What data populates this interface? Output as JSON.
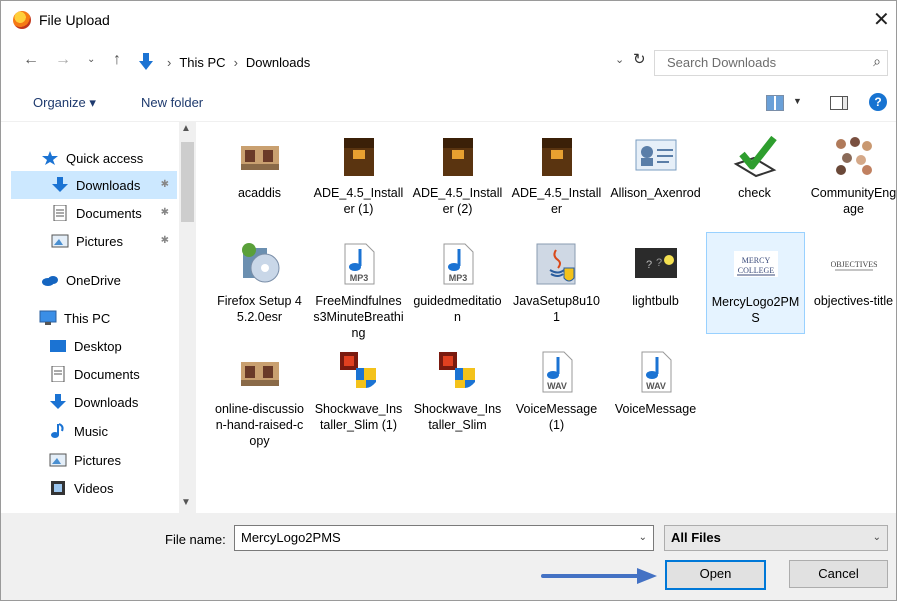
{
  "window": {
    "title": "File Upload",
    "close": "✕"
  },
  "address": {
    "crumbs": [
      "This PC",
      "Downloads"
    ],
    "search_placeholder": "Search Downloads"
  },
  "toolbar": {
    "organize": "Organize ▾",
    "new_folder": "New folder",
    "help": "?"
  },
  "sidebar": {
    "items": [
      {
        "label": "Quick access"
      },
      {
        "label": "Downloads"
      },
      {
        "label": "Documents"
      },
      {
        "label": "Pictures"
      },
      {
        "label": "OneDrive"
      },
      {
        "label": "This PC"
      },
      {
        "label": "Desktop"
      },
      {
        "label": "Documents"
      },
      {
        "label": "Downloads"
      },
      {
        "label": "Music"
      },
      {
        "label": "Pictures"
      },
      {
        "label": "Videos"
      }
    ]
  },
  "files": [
    {
      "name": "acaddis",
      "icon": "image-thumbnail-icon"
    },
    {
      "name": "ADE_4.5_Installer (1)",
      "icon": "installer-box-icon"
    },
    {
      "name": "ADE_4.5_Installer (2)",
      "icon": "installer-box-icon"
    },
    {
      "name": "ADE_4.5_Installer",
      "icon": "installer-box-icon"
    },
    {
      "name": "Allison_Axenrod",
      "icon": "contact-card-icon"
    },
    {
      "name": "check",
      "icon": "checkmark-image-icon"
    },
    {
      "name": "CommunityEngage",
      "icon": "people-image-icon"
    },
    {
      "name": "Firefox Setup 45.2.0esr",
      "icon": "setup-cd-icon"
    },
    {
      "name": "FreeMindfulness3MinuteBreathing",
      "icon": "mp3-icon",
      "ext": "MP3"
    },
    {
      "name": "guidedmeditation",
      "icon": "mp3-icon",
      "ext": "MP3"
    },
    {
      "name": "JavaSetup8u101",
      "icon": "java-installer-icon"
    },
    {
      "name": "lightbulb",
      "icon": "lightbulb-image-icon"
    },
    {
      "name": "MercyLogo2PMS",
      "icon": "mercy-logo-icon",
      "logo_text": "MERCY COLLEGE",
      "selected": true
    },
    {
      "name": "objectives-title",
      "icon": "objectives-image-icon",
      "logo_text": "OBJECTIVES"
    },
    {
      "name": "online-discussion-hand-raised-copy",
      "icon": "image-thumbnail-icon"
    },
    {
      "name": "Shockwave_Installer_Slim (1)",
      "icon": "shockwave-installer-icon"
    },
    {
      "name": "Shockwave_Installer_Slim",
      "icon": "shockwave-installer-icon"
    },
    {
      "name": "VoiceMessage (1)",
      "icon": "wav-icon",
      "ext": "WAV"
    },
    {
      "name": "VoiceMessage",
      "icon": "wav-icon",
      "ext": "WAV"
    }
  ],
  "bottom": {
    "file_name_label": "File name:",
    "file_name_value": "MercyLogo2PMS",
    "file_type": "All Files",
    "open": "Open",
    "cancel": "Cancel"
  },
  "colors": {
    "accent": "#0078d7",
    "selection": "#cce8ff",
    "arrow": "#4472c4"
  }
}
